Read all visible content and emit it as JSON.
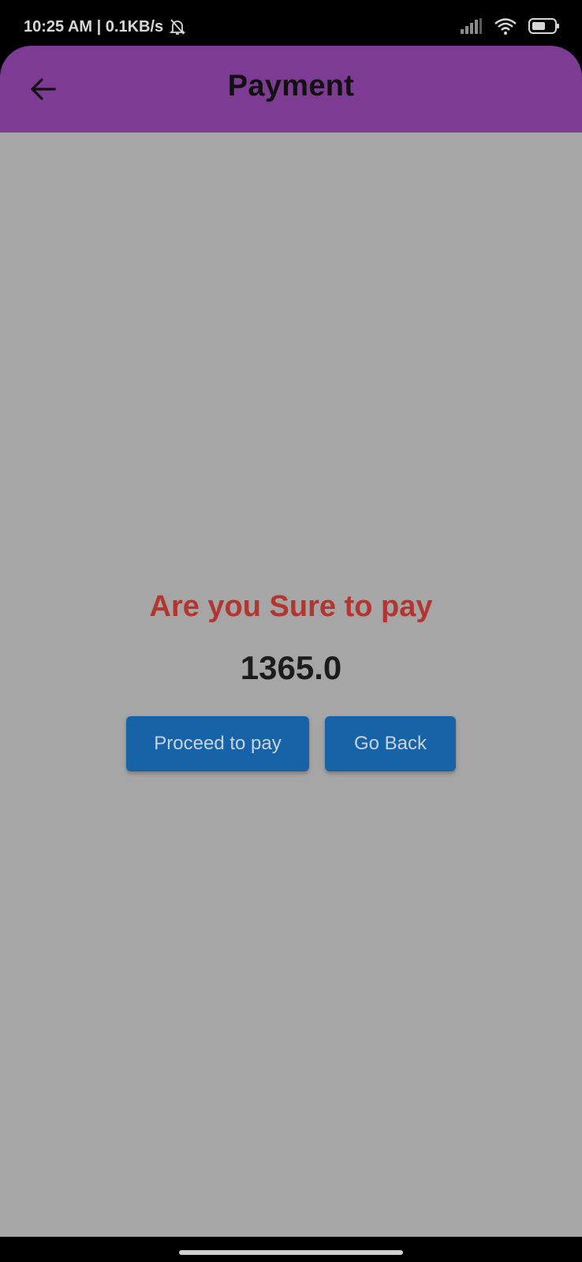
{
  "status_bar": {
    "time_speed": "10:25 AM | 0.1KB/s",
    "battery_icon": "battery-icon",
    "wifi_icon": "wifi-icon",
    "signal_icon": "signal-icon",
    "muted_bell_icon": "bell-off-icon"
  },
  "app_bar": {
    "title": "Payment",
    "back_icon": "arrow-left-icon",
    "color": "#7d3b93"
  },
  "dialog": {
    "question": "Are you Sure to pay",
    "amount": "1365.0",
    "proceed_label": "Proceed to pay",
    "back_label": "Go Back",
    "question_color": "#b3352f",
    "button_color": "#1763a8"
  }
}
